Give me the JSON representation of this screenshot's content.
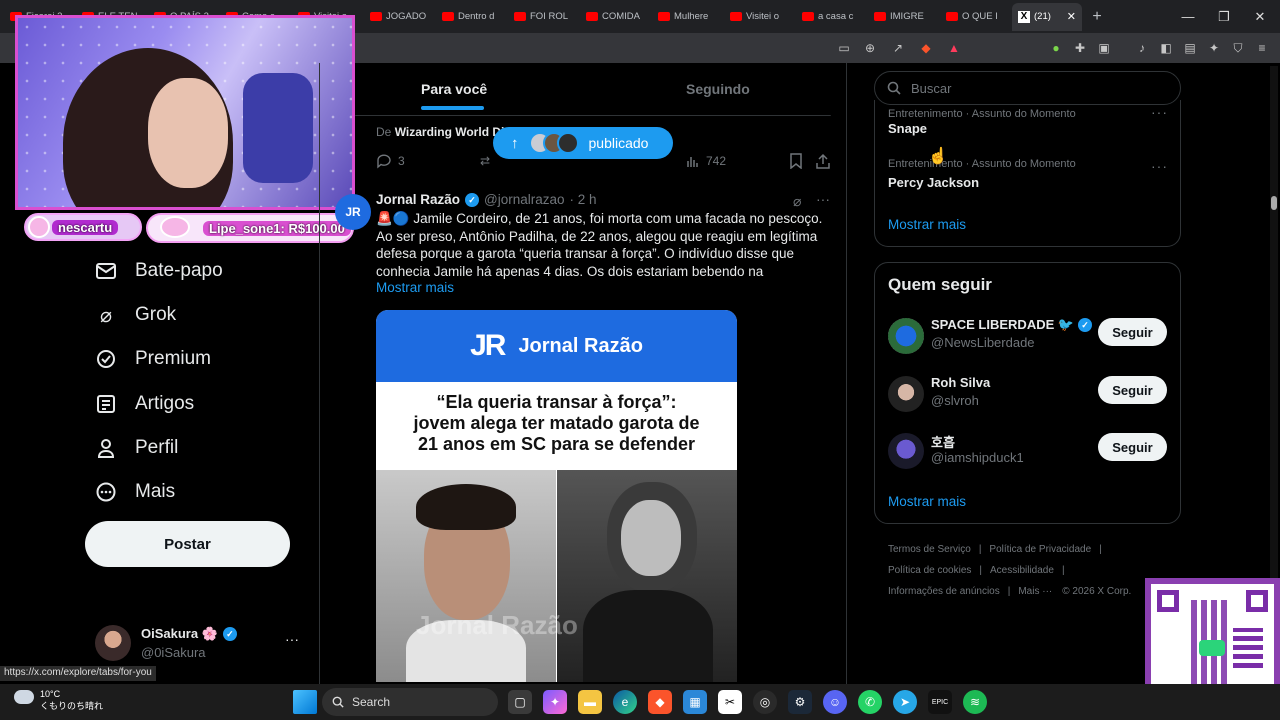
{
  "browser": {
    "tabs": [
      {
        "label": "Ficarei 2"
      },
      {
        "label": "ELE TEN"
      },
      {
        "label": "O PAÍS 2"
      },
      {
        "label": "Como c"
      },
      {
        "label": "Visitei a"
      },
      {
        "label": "JOGADO"
      },
      {
        "label": "Dentro d"
      },
      {
        "label": "FOI ROL"
      },
      {
        "label": "COMIDA"
      },
      {
        "label": "Mulhere"
      },
      {
        "label": "Visitei o"
      },
      {
        "label": "a casa c"
      },
      {
        "label": "IMIGRE"
      },
      {
        "label": "O QUE I"
      }
    ],
    "active_tab": {
      "label": "(21)"
    },
    "new_tab": "+",
    "status_url": "https://x.com/explore/tabs/for-you"
  },
  "stream": {
    "chat1": "nescartu",
    "chat2": "Lipe_sone1: R$100.00"
  },
  "nav": {
    "items": [
      {
        "label": "Bate-papo",
        "icon": "mail-icon"
      },
      {
        "label": "Grok",
        "icon": "grok-icon"
      },
      {
        "label": "Premium",
        "icon": "verified-icon"
      },
      {
        "label": "Artigos",
        "icon": "article-icon"
      },
      {
        "label": "Perfil",
        "icon": "person-icon"
      },
      {
        "label": "Mais",
        "icon": "more-circle-icon"
      }
    ],
    "post_button": "Postar",
    "profile": {
      "name": "OiSakura 🌸",
      "handle": "@0iSakura",
      "more": "···"
    }
  },
  "timeline": {
    "tabs": [
      "Para você",
      "Seguindo"
    ],
    "prev_tweet": {
      "source_prefix": "De",
      "source": "Wizarding World Di",
      "replies": "3",
      "views": "742"
    },
    "new_posts_pill": "publicado",
    "tweet": {
      "author": "Jornal Razão",
      "handle": "@jornalrazao",
      "time": "· 2 h",
      "emoji": "🚨🔵",
      "text": "Jamile Cordeiro, de 21 anos, foi morta com uma facada no pescoço. Ao ser preso, Antônio Padilha, de 22 anos, alegou que reagiu em legítima defesa porque a garota “queria transar à força”. O indivíduo disse que conhecia Jamile há apenas 4 dias. Os dois estariam bebendo na",
      "show_more": "Mostrar mais",
      "image": {
        "logo": "JR",
        "brand": "Jornal Razão",
        "headline_line1": "“Ela queria transar à força”:",
        "headline_line2": "jovem alega ter matado garota de",
        "headline_line3": "21 anos em SC para se defender",
        "watermark": "Jornal Razão"
      }
    }
  },
  "sidebar": {
    "search_placeholder": "Buscar",
    "trends": [
      {
        "category": "Entretenimento · Assunto do Momento",
        "name": "Snape"
      },
      {
        "category": "Entretenimento · Assunto do Momento",
        "name": "Percy Jackson"
      }
    ],
    "trends_more": "Mostrar mais",
    "who_to_follow": {
      "title": "Quem seguir",
      "items": [
        {
          "name": "SPACE LIBERDADE 🐦",
          "handle": "@NewsLiberdade",
          "button": "Seguir",
          "verified": true
        },
        {
          "name": "Roh Silva",
          "handle": "@slvroh",
          "button": "Seguir",
          "verified": false
        },
        {
          "name": "호흡",
          "handle": "@iamshipduck1",
          "button": "Seguir",
          "verified": false
        }
      ],
      "more": "Mostrar mais"
    },
    "footer": {
      "line1": [
        "Termos de Serviço",
        "Política de Privacidade"
      ],
      "line2": [
        "Política de cookies",
        "Acessibilidade"
      ],
      "line3": [
        "Informações de anúncios",
        "Mais ···",
        "© 2026 X Corp."
      ]
    }
  },
  "taskbar": {
    "weather_temp": "10°C",
    "weather_desc": "くもりのち晴れ",
    "search": "Search"
  },
  "colors": {
    "accent": "#1d9bf0",
    "background": "#000000",
    "stream_border": "#d94fd0"
  }
}
